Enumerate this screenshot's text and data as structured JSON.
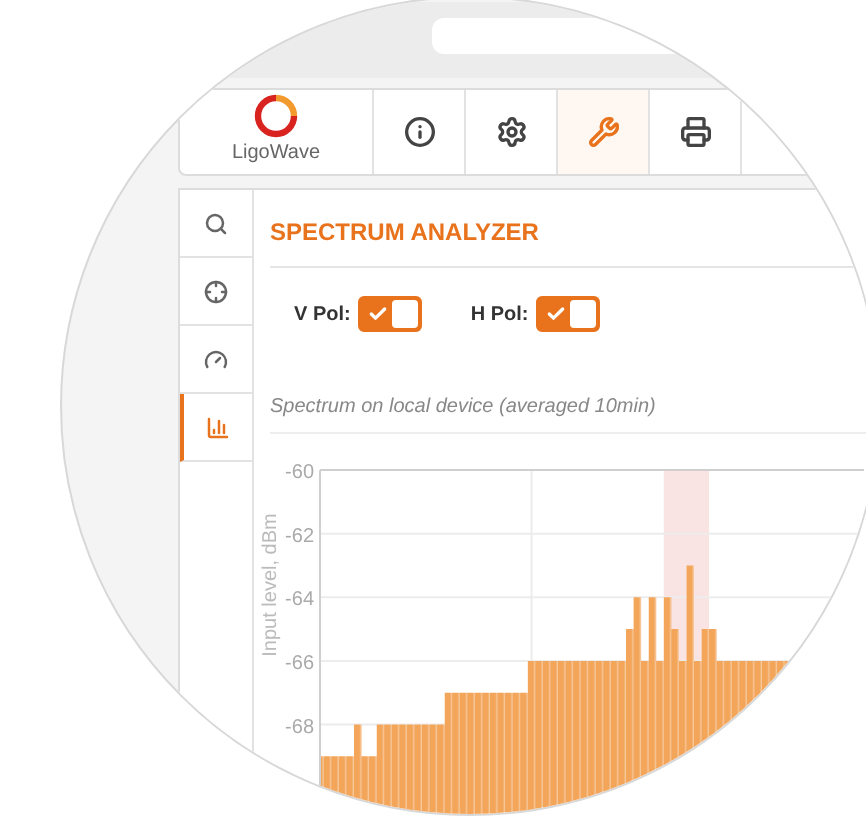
{
  "nav": {
    "logo_text": "LigoWave",
    "items": [
      {
        "selected": false
      },
      {
        "selected": false
      },
      {
        "selected": true
      },
      {
        "selected": false
      }
    ]
  },
  "sidebar": {
    "items": [
      {
        "selected": false
      },
      {
        "selected": false
      },
      {
        "selected": false
      },
      {
        "selected": true
      }
    ]
  },
  "panel": {
    "title": "SPECTRUM ANALYZER",
    "toggles": [
      {
        "label": "V Pol:",
        "checked": true
      },
      {
        "label": "H Pol:",
        "checked": true
      }
    ],
    "caption": "Spectrum on local device (averaged 10min)",
    "chart_data": {
      "type": "area",
      "ylabel": "Input level, dBm",
      "ylim": [
        -71,
        -60
      ],
      "yticks": [
        -60,
        -62,
        -64,
        -66,
        -68
      ],
      "grid": true,
      "values": [
        -69,
        -69,
        -69,
        -69,
        -69,
        -68,
        -69,
        -69,
        -68,
        -68,
        -68,
        -68,
        -68,
        -68,
        -68,
        -68,
        -68,
        -67,
        -67,
        -67,
        -67,
        -67,
        -67,
        -67,
        -67,
        -67,
        -67,
        -67,
        -66,
        -66,
        -66,
        -66,
        -66,
        -66,
        -66,
        -66,
        -66,
        -66,
        -66,
        -66,
        -66,
        -65,
        -64,
        -66,
        -64,
        -66,
        -64,
        -65,
        -66,
        -63,
        -66,
        -65,
        -65,
        -66,
        -66,
        -66,
        -66,
        -66,
        -66,
        -66,
        -66,
        -66,
        -66,
        -66,
        -66,
        -66,
        -66,
        -66,
        -66,
        -66,
        -66,
        -66,
        -66
      ]
    }
  }
}
